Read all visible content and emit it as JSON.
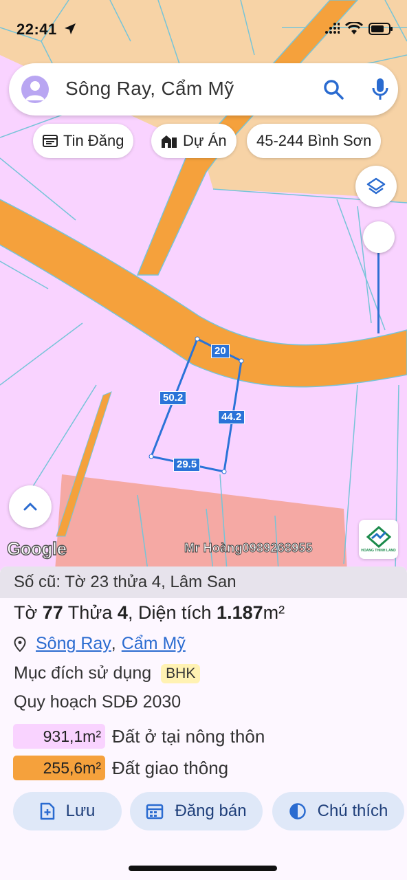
{
  "status_bar": {
    "time": "22:41"
  },
  "search": {
    "query": "Sông Ray, Cẩm Mỹ"
  },
  "chips": [
    {
      "label": "Tin Đăng",
      "icon": "listing-icon"
    },
    {
      "label": "Dự Án",
      "icon": "buildings-icon"
    },
    {
      "label": "45-244 Bình Sơn",
      "icon": ""
    }
  ],
  "map": {
    "dimensions": {
      "top": "20",
      "left": "50.2",
      "right": "44.2",
      "bottom": "29.5"
    },
    "attribution": "Google",
    "watermark": "Mr Hoàng0989268955",
    "brand_logo_text": "HOANG THINH LAND",
    "colors": {
      "residential": "#f9d3ff",
      "road": "#f5a13c",
      "other_land": "#f7d3a6",
      "commercial": "#f5a9a4",
      "boundary": "#2a73d8"
    }
  },
  "info": {
    "old_info": "Số cũ: Tờ 23 thửa 4, Lâm San",
    "title": {
      "sheet_label": "Tờ",
      "sheet": "77",
      "parcel_label": "Thửa",
      "parcel": "4",
      "area_label": "Diện tích",
      "area": "1.187",
      "unit": "m²"
    },
    "location": {
      "commune": "Sông Ray",
      "district": "Cẩm Mỹ"
    },
    "purpose_label": "Mục đích sử dụng",
    "purpose_code": "BHK",
    "plan_title": "Quy hoạch SDĐ 2030",
    "zones": [
      {
        "area": "931,1m²",
        "label": "Đất ở tại nông thôn",
        "color": "#f9d3ff"
      },
      {
        "area": "255,6m²",
        "label": "Đất giao thông",
        "color": "#f5a13c"
      }
    ]
  },
  "actions": {
    "save": "Lưu",
    "post_sale": "Đăng bán",
    "legend": "Chú thích"
  }
}
